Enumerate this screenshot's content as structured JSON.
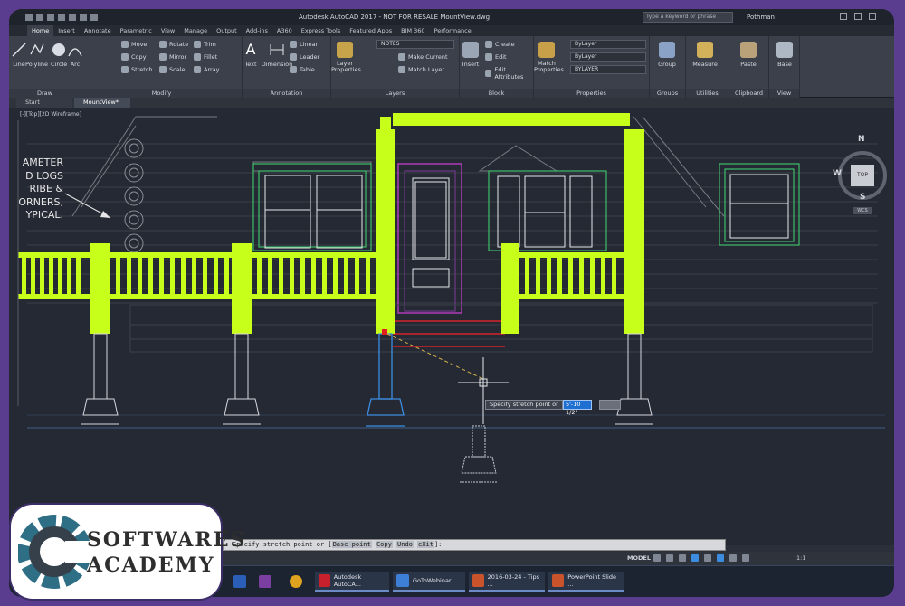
{
  "titlebar": {
    "title": "Autodesk AutoCAD 2017 - NOT FOR RESALE    MountView.dwg",
    "search_placeholder": "Type a keyword or phrase",
    "user": "Pothman"
  },
  "ribbon_tabs": [
    "Home",
    "Insert",
    "Annotate",
    "Parametric",
    "View",
    "Manage",
    "Output",
    "Add-ins",
    "A360",
    "Express Tools",
    "Featured Apps",
    "BIM 360",
    "Performance"
  ],
  "ribbon": {
    "draw": {
      "title": "Draw",
      "line": "Line",
      "polyline": "Polyline",
      "circle": "Circle",
      "arc": "Arc"
    },
    "modify": {
      "title": "Modify",
      "move": "Move",
      "rotate": "Rotate",
      "trim": "Trim",
      "copy": "Copy",
      "mirror": "Mirror",
      "fillet": "Fillet",
      "stretch": "Stretch",
      "scale": "Scale",
      "array": "Array"
    },
    "annotation": {
      "title": "Annotation",
      "text": "Text",
      "dimension": "Dimension",
      "linear": "Linear",
      "leader": "Leader",
      "table": "Table"
    },
    "layers": {
      "title": "Layers",
      "layer_properties": "Layer Properties",
      "current_layer": "NOTES",
      "make_current": "Make Current",
      "match_layer": "Match Layer"
    },
    "block": {
      "title": "Block",
      "insert": "Insert",
      "create": "Create",
      "edit": "Edit",
      "edit_attributes": "Edit Attributes"
    },
    "properties": {
      "title": "Properties",
      "match_properties": "Match Properties",
      "color": "ByLayer",
      "linetype": "ByLayer",
      "lineweight": "BYLAYER"
    },
    "groups": {
      "title": "Groups",
      "group": "Group"
    },
    "utilities": {
      "title": "Utilities",
      "measure": "Measure"
    },
    "clipboard": {
      "title": "Clipboard",
      "paste": "Paste"
    },
    "view": {
      "title": "View",
      "base": "Base"
    }
  },
  "file_tabs": [
    "Start",
    "MountView*"
  ],
  "viewport": {
    "label": "[-][Top][2D Wireframe]",
    "note_lines": [
      "AMETER",
      "D LOGS",
      "RIBE &",
      "ORNERS,",
      "YPICAL."
    ],
    "viewcube": {
      "north": "N",
      "west": "W",
      "south": "S",
      "top": "TOP",
      "wcs": "WCS"
    }
  },
  "dynamic_input": {
    "prompt": "Specify stretch point or",
    "value": "5'-10 1/2\""
  },
  "command_line": {
    "prefix": "Specify stretch point or [",
    "options": [
      "Base point",
      "Copy",
      "Undo",
      "eXit"
    ],
    "suffix": "]:"
  },
  "statusbar": {
    "model": "MODEL",
    "scale": "1:1"
  },
  "taskbar": [
    {
      "label": "",
      "color": "#2b5fb7"
    },
    {
      "label": "",
      "color": "#7a3fa0"
    },
    {
      "label": "",
      "color": "#e0a31f"
    },
    {
      "label": "Autodesk AutoCA...",
      "color": "#c8202d"
    },
    {
      "label": "GoToWebinar",
      "color": "#3d7fd6"
    },
    {
      "label": "2016-03-24 - Tips ...",
      "color": "#c9542b"
    },
    {
      "label": "PowerPoint Slide ...",
      "color": "#c9542b"
    }
  ],
  "logo": {
    "line1": "SOFTWARES",
    "line2": "ACADEMY"
  },
  "colors": {
    "lime": "#c8ff1a",
    "grid_line": "#3f5f86",
    "accent_blue": "#1f6fd1"
  }
}
